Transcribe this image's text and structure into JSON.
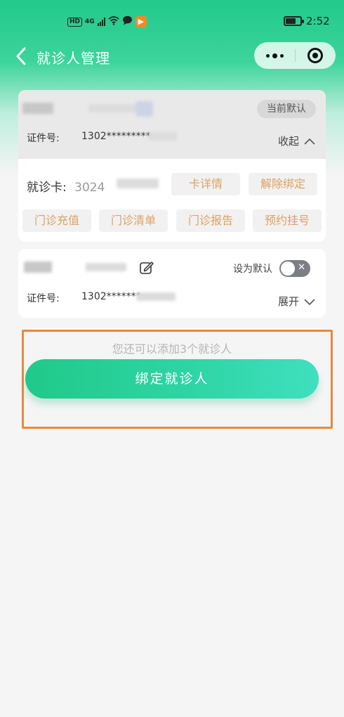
{
  "status_bar": {
    "hd": "HD",
    "signal": "4G",
    "wifi_icon": "wifi-icon",
    "chat_icon": "chat-bubble-icon",
    "app_icon": "media-app-icon",
    "battery_icon": "battery-icon",
    "time": "2:52"
  },
  "navbar": {
    "back_icon": "chevron-left-icon",
    "title": "就诊人管理",
    "capsule_more_icon": "more-dots-icon",
    "capsule_close_icon": "target-close-icon"
  },
  "patient1": {
    "default_tag": "当前默认",
    "id_label": "证件号:",
    "id_value": "1302*********",
    "collapse_label": "收起",
    "collapse_icon": "chevron-up-icon",
    "card_label": "就诊卡:",
    "card_number_partial": "3024",
    "actions": [
      "卡详情",
      "解除绑定"
    ],
    "services": [
      "门诊充值",
      "门诊清单",
      "门诊报告",
      "预约挂号"
    ]
  },
  "patient2": {
    "edit_icon": "edit-icon",
    "set_default_label": "设为默认",
    "switch_on": false,
    "id_label": "证件号:",
    "id_value": "1302*******",
    "expand_label": "展开",
    "expand_icon": "chevron-down-icon"
  },
  "footer": {
    "hint": "您还可以添加3个就诊人",
    "bind_button": "绑定就诊人"
  },
  "colors": {
    "brand_green": "#21c98a",
    "accent_orange": "#e0a060",
    "highlight": "#e78a3c"
  }
}
